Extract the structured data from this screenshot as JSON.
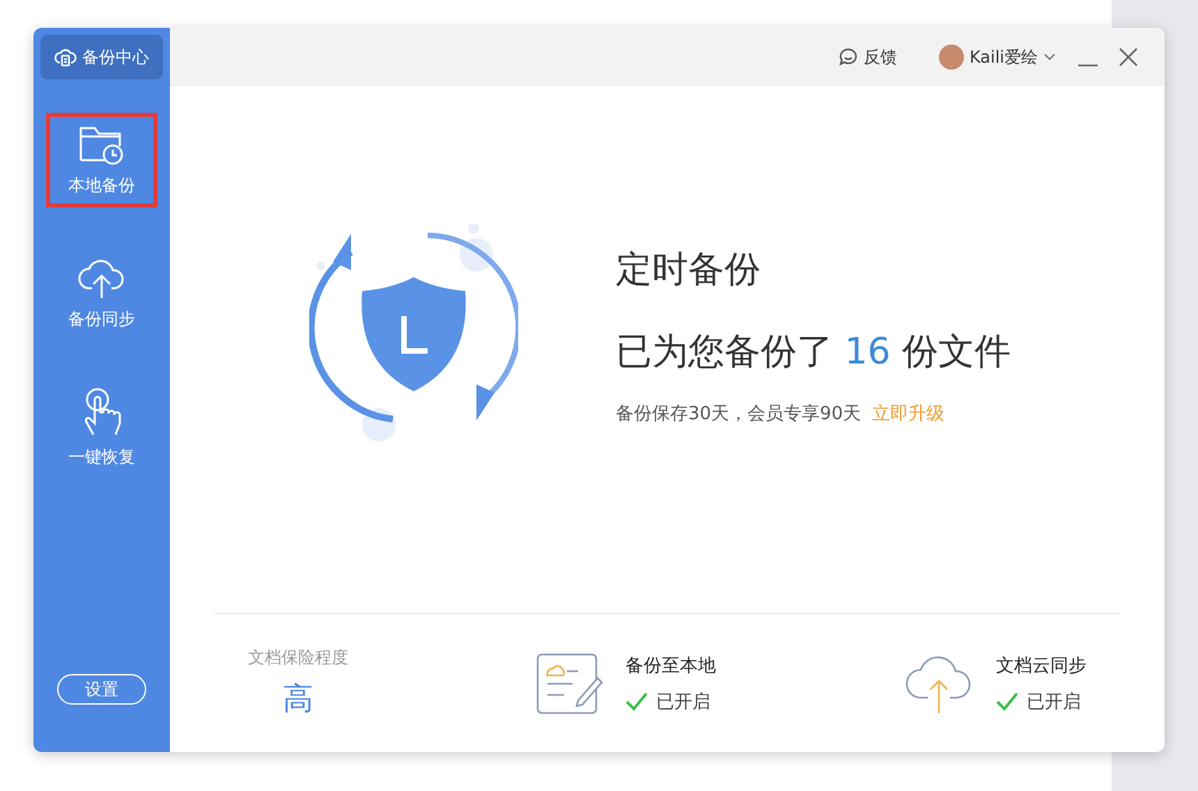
{
  "sidebar": {
    "header": "备份中心",
    "items": [
      {
        "label": "本地备份",
        "kind": "local",
        "selected": true
      },
      {
        "label": "备份同步",
        "kind": "sync",
        "selected": false
      },
      {
        "label": "一键恢复",
        "kind": "restore",
        "selected": false
      }
    ],
    "settings": "设置"
  },
  "topbar": {
    "feedback": "反馈",
    "user": "Kaili爱绘"
  },
  "hero": {
    "title": "定时备份",
    "count_before": "已为您备份了",
    "count": "16",
    "count_after": "份文件",
    "note": "备份保存30天，会员专享90天",
    "upgrade": "立即升级"
  },
  "status": {
    "level_label": "文档保险程度",
    "level_value": "高",
    "features": [
      {
        "kind": "local",
        "title": "备份至本地",
        "state": "已开启",
        "enabled": true
      },
      {
        "kind": "cloud",
        "title": "文档云同步",
        "state": "已开启",
        "enabled": true
      }
    ]
  }
}
